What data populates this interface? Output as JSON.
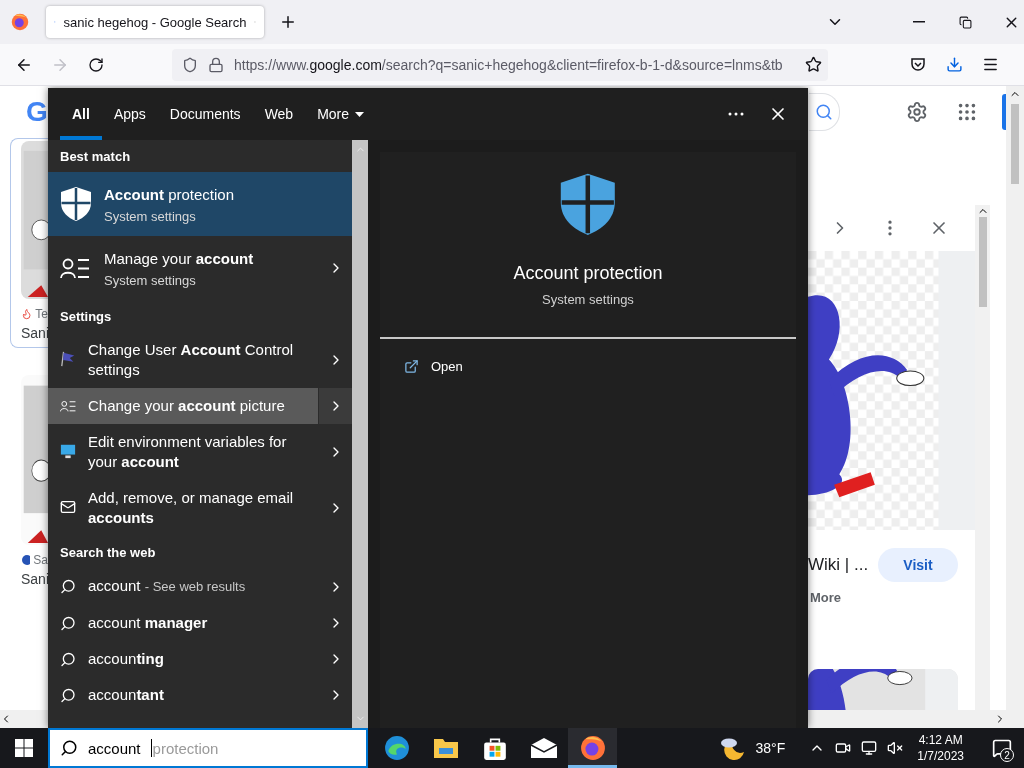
{
  "browser": {
    "tab": {
      "title": "sanic hegehog - Google Search"
    },
    "forward_disabled": true,
    "url": {
      "scheme": "https://www.",
      "domain": "google.com",
      "path": "/search?q=sanic+hegehog&client=firefox-b-1-d&source=lnms&tb"
    }
  },
  "page": {
    "logo": "G",
    "results": [
      {
        "source": "Te",
        "title": "Sani"
      },
      {
        "source": "Sa",
        "title": "Sani"
      }
    ],
    "preview": {
      "title": "Wiki | ...",
      "button": "Visit",
      "more": "More"
    }
  },
  "search_panel": {
    "tabs": [
      {
        "label": "All",
        "selected": true
      },
      {
        "label": "Apps",
        "selected": false
      },
      {
        "label": "Documents",
        "selected": false
      },
      {
        "label": "Web",
        "selected": false
      },
      {
        "label": "More",
        "selected": false
      }
    ],
    "sections": [
      {
        "heading": "Best match",
        "kind": "best",
        "items": [
          {
            "title": "**Account** protection",
            "subtitle": "System settings",
            "selected": true,
            "hovered": false
          },
          {
            "title": "Manage your **account**",
            "subtitle": "System settings",
            "selected": false,
            "hovered": false
          }
        ]
      },
      {
        "heading": "Settings",
        "kind": "setting",
        "items": [
          {
            "title": "Change User **Account** Control settings",
            "selected": false,
            "hovered": false
          },
          {
            "title": "Change your **account** picture",
            "selected": false,
            "hovered": true
          },
          {
            "title": "Edit environment variables for your **account**",
            "selected": false,
            "hovered": false
          },
          {
            "title": "Add, remove, or manage email **accounts**",
            "selected": false,
            "hovered": false
          }
        ]
      },
      {
        "heading": "Search the web",
        "kind": "web",
        "items": [
          {
            "title": "account",
            "hint": "- See web results",
            "selected": false,
            "hovered": false
          },
          {
            "title": "account **manager**",
            "selected": false,
            "hovered": false
          },
          {
            "title": "accoun**ting**",
            "selected": false,
            "hovered": false
          },
          {
            "title": "accoun**tant**",
            "selected": false,
            "hovered": false
          }
        ]
      }
    ],
    "detail": {
      "title": "Account protection",
      "subtitle": "System settings",
      "actions": [
        {
          "label": "Open"
        }
      ]
    }
  },
  "taskbar": {
    "search": {
      "value": "account",
      "suggestion": "protection"
    },
    "apps": [
      {
        "active": false
      },
      {
        "active": false
      },
      {
        "active": false
      },
      {
        "active": false
      },
      {
        "active": true
      }
    ],
    "weather": "38°F",
    "time": "4:12 AM",
    "date": "1/7/2023",
    "notifications": "2"
  }
}
